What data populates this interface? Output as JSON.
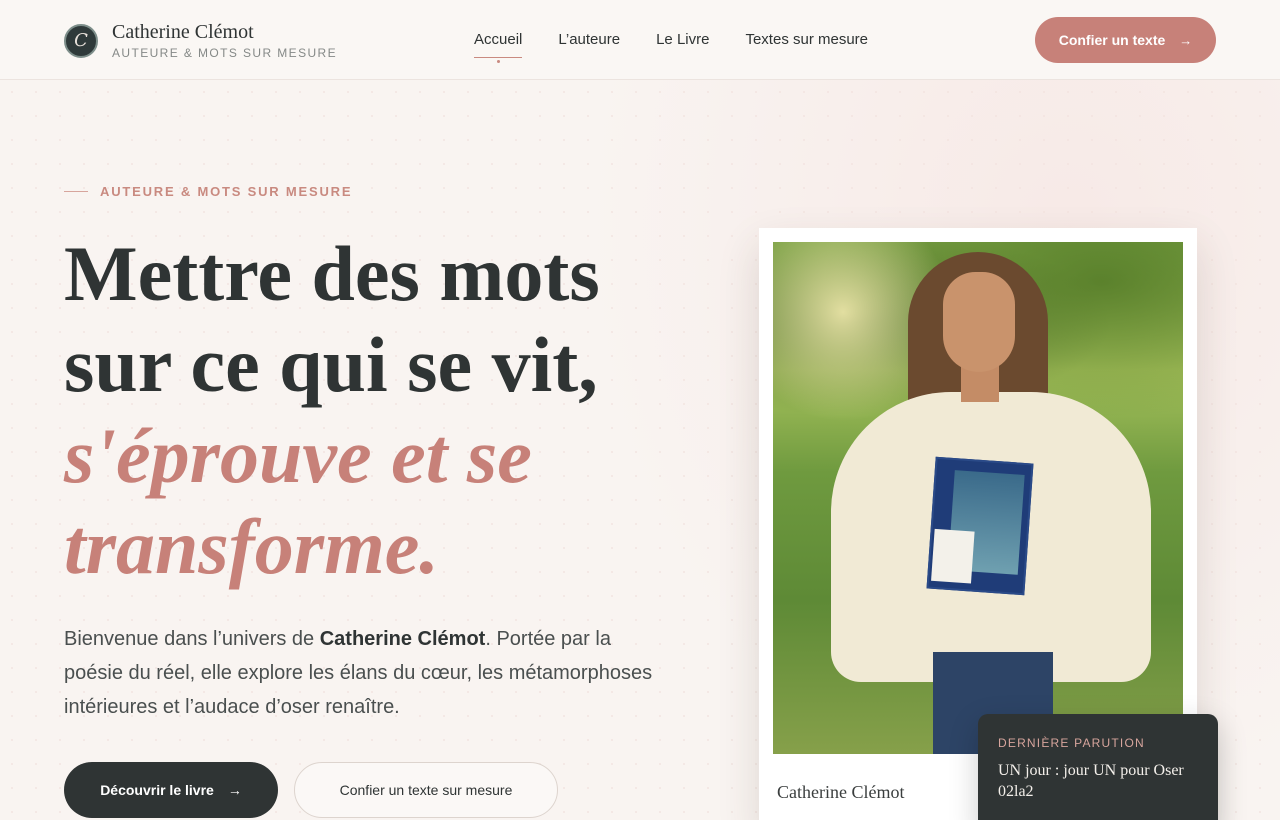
{
  "brand": {
    "name": "Catherine Clémot",
    "tagline": "AUTEURE & MOTS SUR MESURE",
    "logo_letter": "C"
  },
  "nav": {
    "items": [
      {
        "label": "Accueil",
        "active": true
      },
      {
        "label": "L’auteure",
        "active": false
      },
      {
        "label": "Le Livre",
        "active": false
      },
      {
        "label": "Textes sur mesure",
        "active": false
      }
    ],
    "cta_label": "Confier un texte",
    "cta_icon": "arrow-right-icon"
  },
  "hero": {
    "eyebrow": "AUTEURE & MOTS SUR MESURE",
    "headline_line1": "Mettre des mots",
    "headline_line2": "sur ce qui se vit,",
    "headline_accent1": "s'éprouve et se",
    "headline_accent2": "transforme.",
    "intro_before": "Bienvenue dans l’univers de ",
    "intro_name": "Catherine Clémot",
    "intro_after": ". Portée par la poésie du réel, elle explore les élans du cœur, les métamorphoses intérieures et l’audace d’oser renaître.",
    "primary_button": "Découvrir le livre",
    "secondary_button": "Confier un texte sur mesure"
  },
  "portrait": {
    "caption": "Catherine Clémot"
  },
  "release": {
    "eyebrow": "DERNIÈRE PARUTION",
    "title": "UN jour : jour UN pour Oser 02la2"
  },
  "colors": {
    "accent": "#c78179",
    "dark": "#2f3434",
    "background": "#f9f4f1"
  }
}
